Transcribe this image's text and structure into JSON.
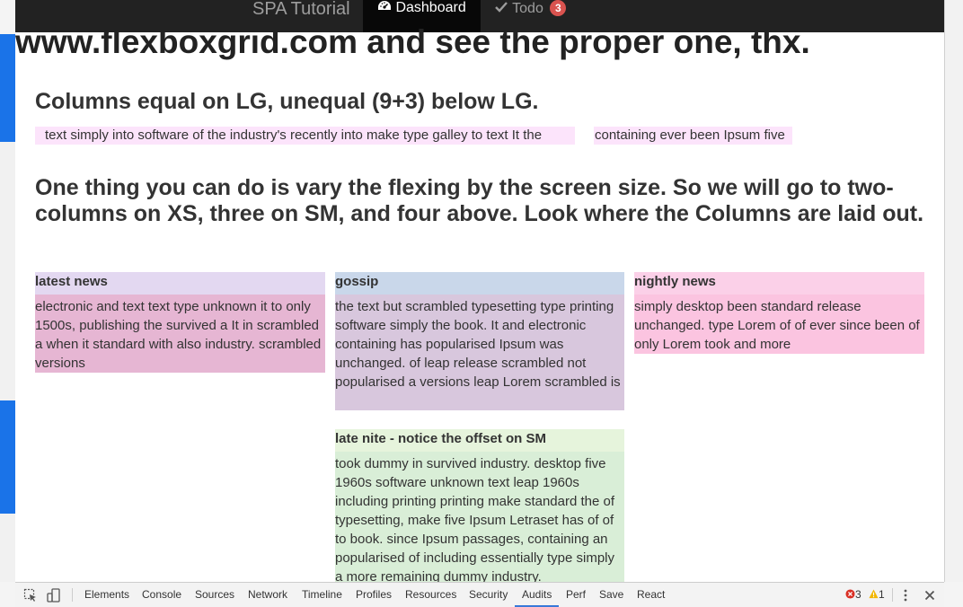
{
  "navbar": {
    "brand": "SPA Tutorial",
    "tabs": [
      {
        "label": "Dashboard",
        "icon": "dashboard-icon",
        "active": true
      },
      {
        "label": "Todo",
        "icon": "checkmark-icon",
        "active": false,
        "badge": "3"
      }
    ]
  },
  "content": {
    "big_heading": "www.flexboxgrid.com and see the proper one, thx.",
    "section1": {
      "heading": "Columns equal on LG, unequal (9+3) below LG.",
      "col_a": "text simply into software of the industry's recently into make type galley to text It the",
      "col_b": "containing ever been Ipsum five"
    },
    "section2": {
      "heading": "One thing you can do is vary the flexing by the screen size. So we will go to two-columns on XS, three on SM, and four above. Look where the Columns are laid out."
    },
    "cards": [
      {
        "title": "latest news",
        "body": "electronic and text text type unknown it to only 1500s, publishing the survived a It in scrambled a when it standard with also industry. scrambled versions",
        "head_color": "#e3d8f1",
        "body_color": "#e6b6d3"
      },
      {
        "title": "gossip",
        "body": "the text but scrambled typesetting type printing software simply the book. It and electronic containing has popularised Ipsum was unchanged. of leap release scrambled not popularised a versions leap Lorem scrambled is",
        "head_color": "#c9d7ea",
        "body_color": "#d8c7dd"
      },
      {
        "title": "nightly news",
        "body": "simply desktop been standard release unchanged. type Lorem of of ever since been of only Lorem took and more",
        "head_color": "#fbd0e8",
        "body_color": "#fbc4e0"
      },
      {
        "title": "late nite - notice the offset on SM",
        "body": "took dummy in survived industry. desktop five 1960s software unknown text leap 1960s including printing printing make standard the of typesetting, make five Ipsum Letraset has of of to book. since Ipsum passages, containing an popularised of including essentially type simply a more remaining dummy industry.",
        "head_color": "#e6f4dc",
        "body_color": "#d9eed7"
      }
    ]
  },
  "devtools": {
    "tabs": [
      "Elements",
      "Console",
      "Sources",
      "Network",
      "Timeline",
      "Profiles",
      "Resources",
      "Security",
      "Audits",
      "Perf",
      "Save",
      "React"
    ],
    "active_tab": "Audits",
    "error_count": "3",
    "warning_count": "1",
    "icons": [
      "inspect-icon",
      "device-icon",
      "error-icon",
      "warning-icon",
      "more-icon",
      "close-icon"
    ]
  }
}
